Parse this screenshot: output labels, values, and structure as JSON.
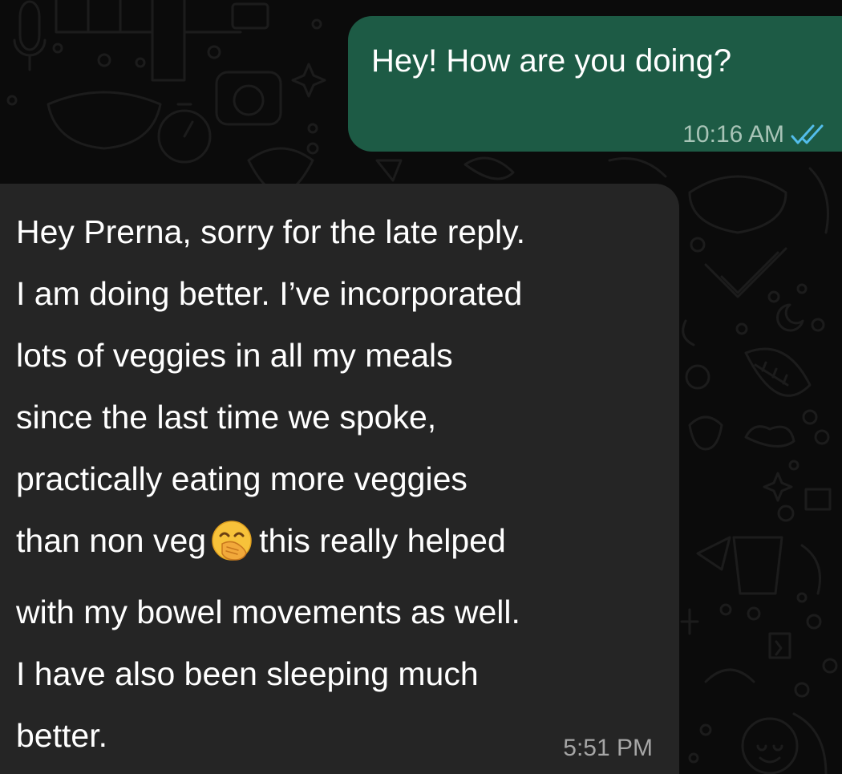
{
  "theme": {
    "background": "#0b0b0b",
    "outgoing_bubble": "#1d5b45",
    "incoming_bubble": "#252525",
    "read_tick_color": "#53bdeb"
  },
  "messages": [
    {
      "direction": "outgoing",
      "text": "Hey! How are you doing?",
      "time": "10:16 AM",
      "status_icon": "double-check-read-icon"
    },
    {
      "direction": "incoming",
      "lines": [
        "Hey Prerna, sorry for the late reply.",
        "I am doing better. I’ve incorporated",
        "lots of veggies in all my meals",
        "since the last time we spoke,",
        "practically eating more veggies",
        "than non veg",
        "this really helped",
        "with my bowel movements as well.",
        "I have also been sleeping much",
        "better."
      ],
      "emoji": "face-with-hand-over-mouth-icon",
      "time": "5:51 PM"
    }
  ]
}
